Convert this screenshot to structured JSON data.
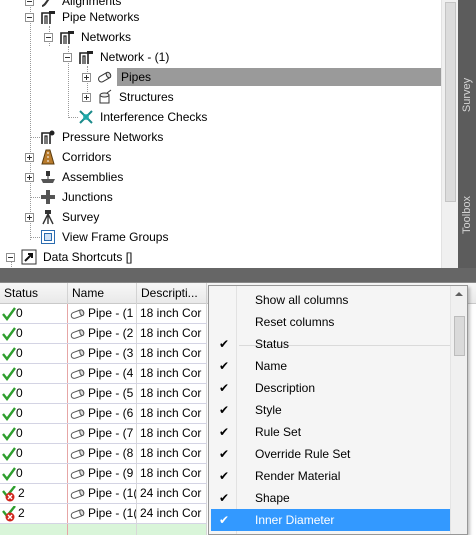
{
  "tree": {
    "items": [
      {
        "label": "Alignments",
        "icon": "alignment-icon",
        "expander": "minus"
      },
      {
        "label": "Pipe Networks",
        "icon": "pipe-network-icon",
        "expander": "minus"
      },
      {
        "label": "Networks",
        "icon": "pipe-network-icon",
        "expander": "minus"
      },
      {
        "label": "Network - (1)",
        "icon": "pipe-network-icon",
        "expander": "minus"
      },
      {
        "label": "Pipes",
        "icon": "pipe-icon",
        "expander": "dot-plus",
        "selected": true
      },
      {
        "label": "Structures",
        "icon": "structure-icon",
        "expander": "dot-plus"
      },
      {
        "label": "Interference Checks",
        "icon": "interference-icon",
        "expander": "none"
      },
      {
        "label": "Pressure Networks",
        "icon": "pressure-network-icon",
        "expander": "none"
      },
      {
        "label": "Corridors",
        "icon": "corridor-icon",
        "expander": "plus"
      },
      {
        "label": "Assemblies",
        "icon": "assembly-icon",
        "expander": "plus"
      },
      {
        "label": "Junctions",
        "icon": "junction-icon",
        "expander": "none"
      },
      {
        "label": "Survey",
        "icon": "survey-icon",
        "expander": "plus"
      },
      {
        "label": "View Frame Groups",
        "icon": "view-frame-icon",
        "expander": "none"
      },
      {
        "label": "Data Shortcuts []",
        "icon": "data-shortcut-icon",
        "expander": "minus"
      }
    ]
  },
  "side_tabs": {
    "survey": "Survey",
    "toolbox": "Toolbox"
  },
  "grid": {
    "columns": [
      "Status",
      "Name",
      "Descripti..."
    ],
    "rows": [
      {
        "status": "0",
        "status_icon": "ok",
        "name": "Pipe - (1",
        "desc": "18 inch Cor"
      },
      {
        "status": "0",
        "status_icon": "ok",
        "name": "Pipe - (2",
        "desc": "18 inch Cor"
      },
      {
        "status": "0",
        "status_icon": "ok",
        "name": "Pipe - (3",
        "desc": "18 inch Cor"
      },
      {
        "status": "0",
        "status_icon": "ok",
        "name": "Pipe - (4",
        "desc": "18 inch Cor"
      },
      {
        "status": "0",
        "status_icon": "ok",
        "name": "Pipe - (5",
        "desc": "18 inch Cor"
      },
      {
        "status": "0",
        "status_icon": "ok",
        "name": "Pipe - (6",
        "desc": "18 inch Cor"
      },
      {
        "status": "0",
        "status_icon": "ok",
        "name": "Pipe - (7",
        "desc": "18 inch Cor"
      },
      {
        "status": "0",
        "status_icon": "ok",
        "name": "Pipe - (8",
        "desc": "18 inch Cor"
      },
      {
        "status": "0",
        "status_icon": "ok",
        "name": "Pipe - (9",
        "desc": "18 inch Cor"
      },
      {
        "status": "2",
        "status_icon": "warning",
        "name": "Pipe - (1(",
        "desc": "24 inch Cor"
      },
      {
        "status": "2",
        "status_icon": "warning",
        "name": "Pipe - (1(",
        "desc": "24 inch Cor"
      }
    ]
  },
  "context_menu": {
    "actions": [
      "Show all columns",
      "Reset columns"
    ],
    "columns": [
      {
        "label": "Status",
        "checked": true
      },
      {
        "label": "Name",
        "checked": true
      },
      {
        "label": "Description",
        "checked": true
      },
      {
        "label": "Style",
        "checked": true
      },
      {
        "label": "Rule Set",
        "checked": true
      },
      {
        "label": "Override Rule Set",
        "checked": true
      },
      {
        "label": "Render Material",
        "checked": true
      },
      {
        "label": "Shape",
        "checked": true
      },
      {
        "label": "Inner Diameter",
        "checked": true,
        "highlighted": true
      }
    ],
    "check_glyph": "✔"
  },
  "colors": {
    "selection": "#9a9a9a",
    "menu_highlight": "#3399ff",
    "ok_green": "#2e9e2e",
    "error_red": "#d0261e",
    "dark_strip": "#5c5c5c"
  }
}
